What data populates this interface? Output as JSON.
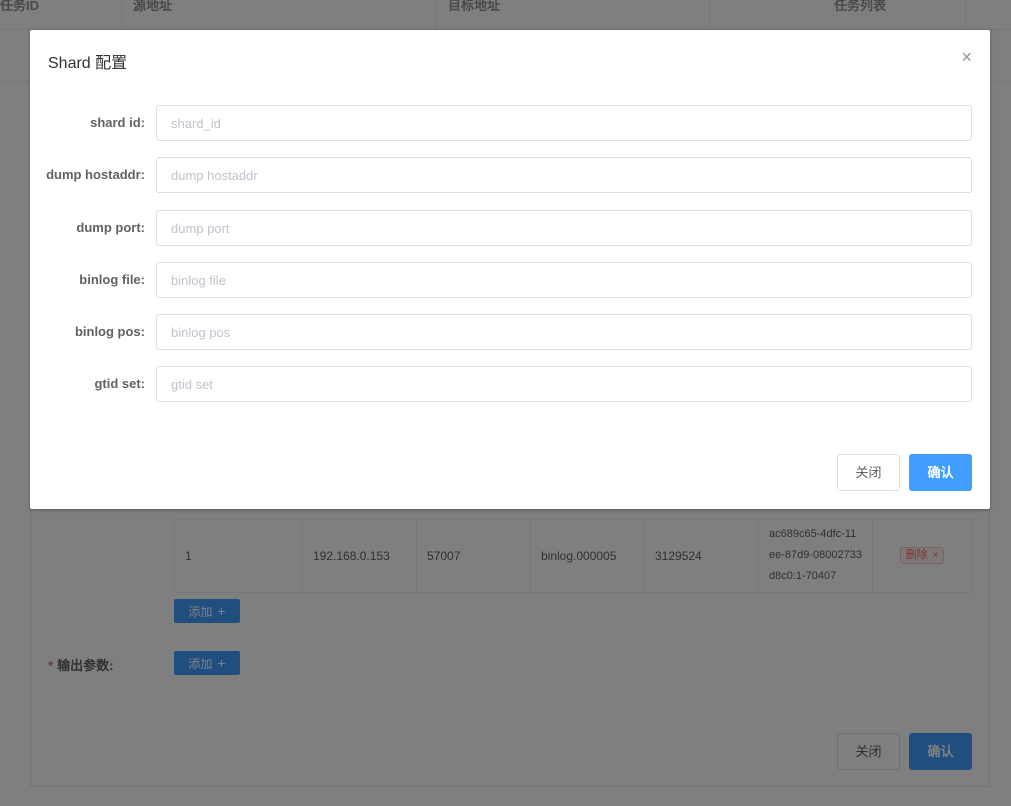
{
  "background": {
    "table_headers": [
      "任务ID",
      "源地址",
      "目标地址",
      "任务列表"
    ],
    "shard_row": {
      "shard_id": "1",
      "hostaddr": "192.168.0.153",
      "port": "57007",
      "binlog_file": "binlog.000005",
      "binlog_pos": "3129524",
      "gtid_set": "ac689c65-4dfc-11ee-87d9-08002733d8c0:1-70407",
      "delete_label": "删除",
      "delete_x": "×"
    },
    "add_label": "添加",
    "add_plus": "+",
    "output_params_required": "*",
    "output_params_label": "输出参数:",
    "close_label": "关闭",
    "confirm_label": "确认"
  },
  "dialog": {
    "title": "Shard 配置",
    "close_icon": "×",
    "fields": [
      {
        "label": "shard id:",
        "placeholder": "shard_id",
        "value": ""
      },
      {
        "label": "dump hostaddr:",
        "placeholder": "dump hostaddr",
        "value": ""
      },
      {
        "label": "dump port:",
        "placeholder": "dump port",
        "value": ""
      },
      {
        "label": "binlog file:",
        "placeholder": "binlog file",
        "value": ""
      },
      {
        "label": "binlog pos:",
        "placeholder": "binlog pos",
        "value": ""
      },
      {
        "label": "gtid set:",
        "placeholder": "gtid set",
        "value": ""
      }
    ],
    "close_label": "关闭",
    "confirm_label": "确认"
  },
  "colors": {
    "primary": "#409eff",
    "danger": "#f56c6c",
    "overlay": "rgba(0,0,0,0.5)"
  }
}
